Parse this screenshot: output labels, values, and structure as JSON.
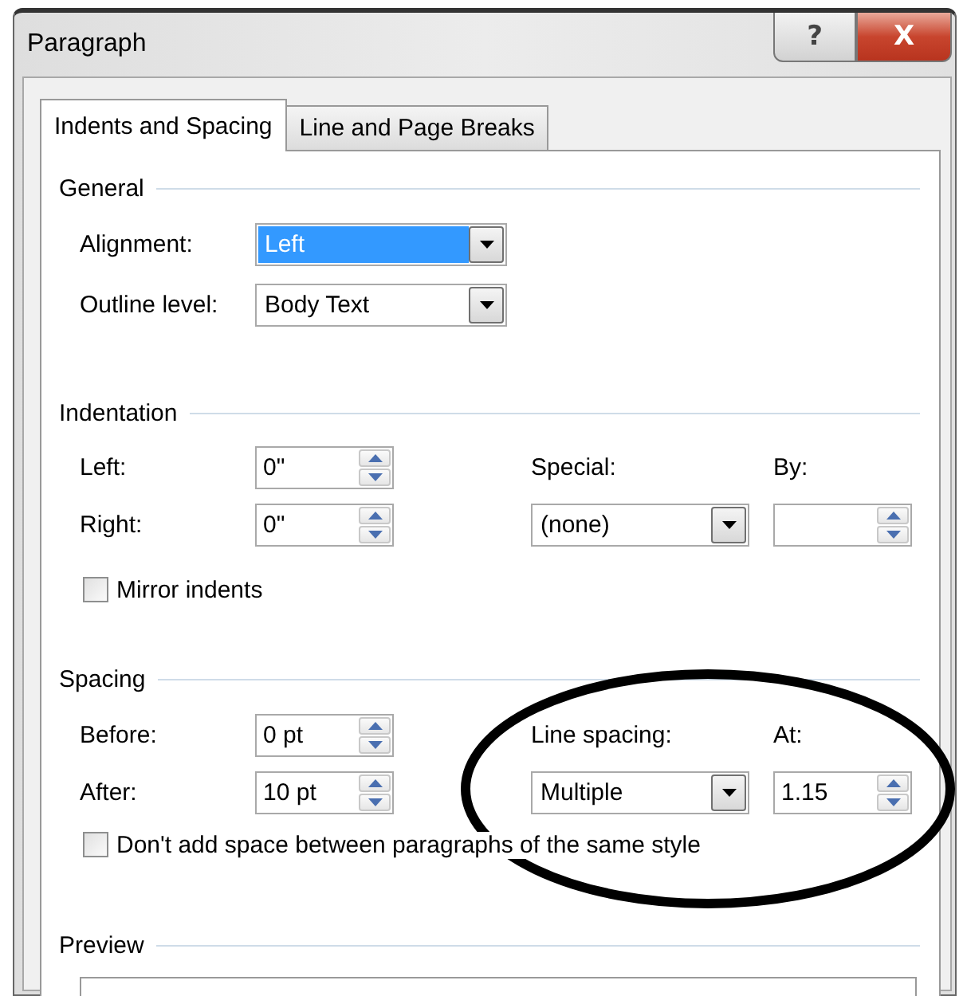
{
  "window": {
    "title": "Paragraph"
  },
  "title_buttons": [
    {
      "kind": "help",
      "label": "?"
    },
    {
      "kind": "close",
      "label": "X"
    }
  ],
  "tabs": [
    {
      "label": "Indents and Spacing",
      "selected": true
    },
    {
      "label": "Line and Page Breaks",
      "selected": false
    }
  ],
  "general": {
    "title": "General",
    "rows": [
      {
        "label": "Alignment:",
        "value": "Left",
        "focused": true
      },
      {
        "label": "Outline level:",
        "value": "Body Text",
        "focused": false
      }
    ]
  },
  "indentation": {
    "title": "Indentation",
    "fields": [
      {
        "label": "Left:",
        "value": "0\""
      },
      {
        "label": "Right:",
        "value": "0\""
      }
    ],
    "special": {
      "label": "Special:",
      "value": "(none)"
    },
    "by": {
      "label": "By:"
    },
    "checkbox": {
      "label": "Mirror indents",
      "checked": false
    }
  },
  "spacing": {
    "title": "Spacing",
    "fields": [
      {
        "label": "Before:",
        "value": "0 pt"
      },
      {
        "label": "After:",
        "value": "10 pt"
      }
    ],
    "line_spacing": {
      "label": "Line spacing:",
      "value": "Multiple"
    },
    "at": {
      "label": "At:",
      "value": "1.15"
    },
    "checkbox": {
      "label": "Don't add space between paragraphs of the same style",
      "checked": false
    }
  },
  "preview": {
    "title": "Preview"
  },
  "annotation": {
    "kind": "ellipse"
  }
}
